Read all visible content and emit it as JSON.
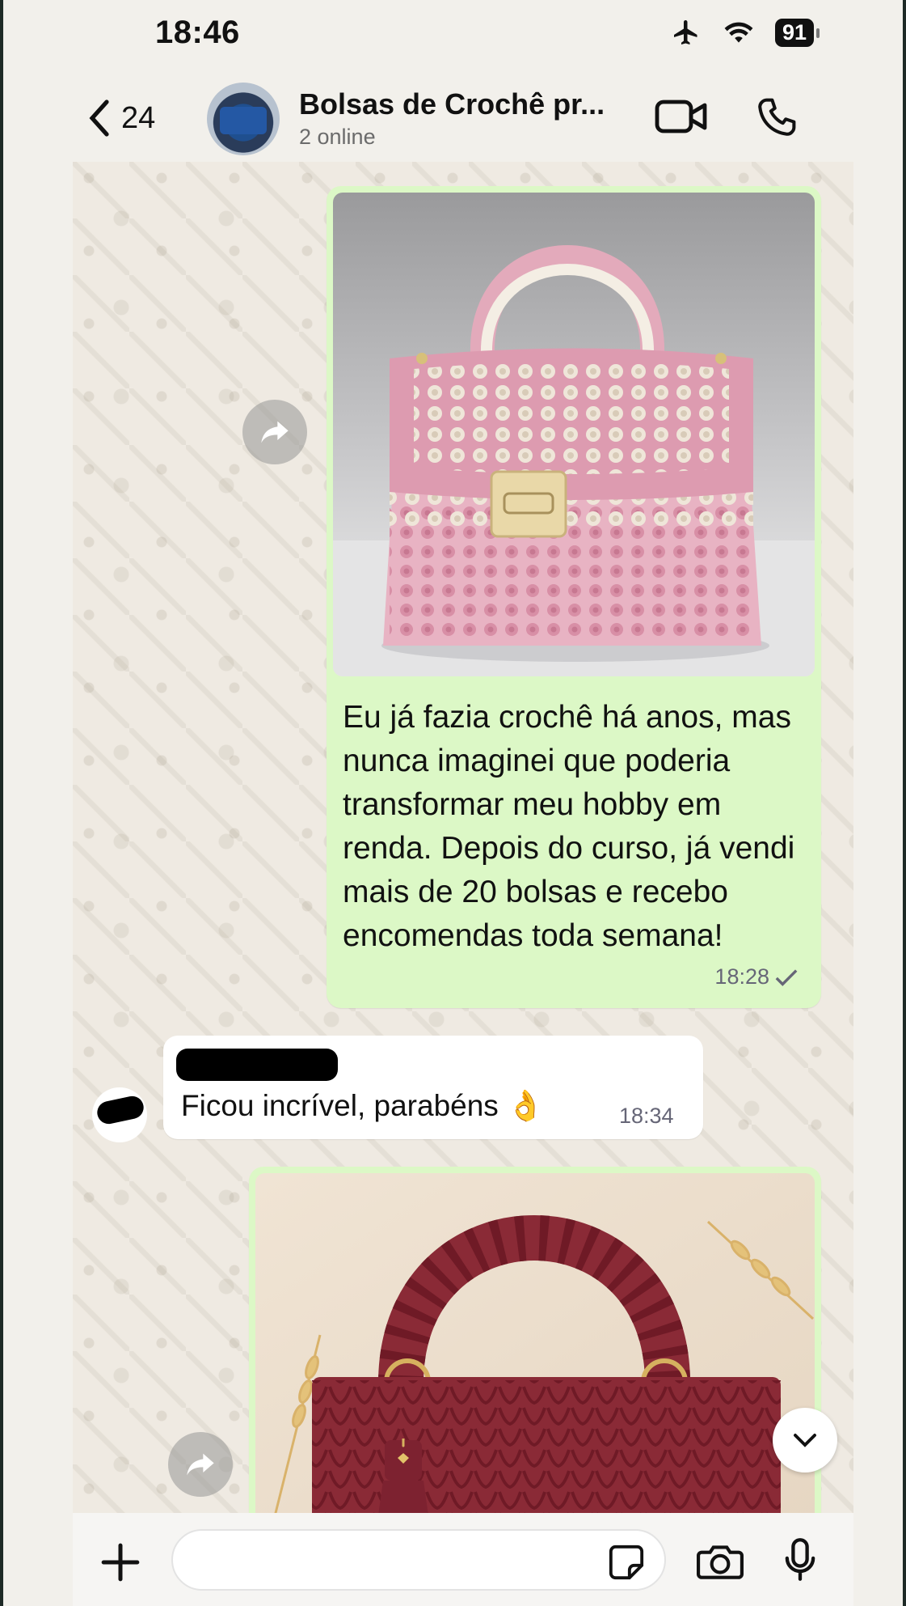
{
  "status_bar": {
    "time": "18:46",
    "battery": "91"
  },
  "header": {
    "back_count": "24",
    "title": "Bolsas de Crochê pr...",
    "subtitle": "2 online"
  },
  "messages": [
    {
      "direction": "outgoing",
      "image": "pink-and-cream-crochet-handbag",
      "text": "Eu já fazia crochê há anos, mas nunca imaginei que poderia transformar meu hobby em renda. Depois do curso, já vendi mais de 20 bolsas e recebo encomendas toda semana!",
      "time": "18:28"
    },
    {
      "direction": "incoming",
      "text": "Ficou incrível, parabéns 👌",
      "time": "18:34"
    },
    {
      "direction": "outgoing",
      "image": "burgundy-chunky-crochet-handbag"
    }
  ],
  "input": {
    "placeholder": ""
  },
  "colors": {
    "outgoing_bubble": "#dcf8c6",
    "incoming_bubble": "#ffffff",
    "chat_background": "#efeae2"
  }
}
